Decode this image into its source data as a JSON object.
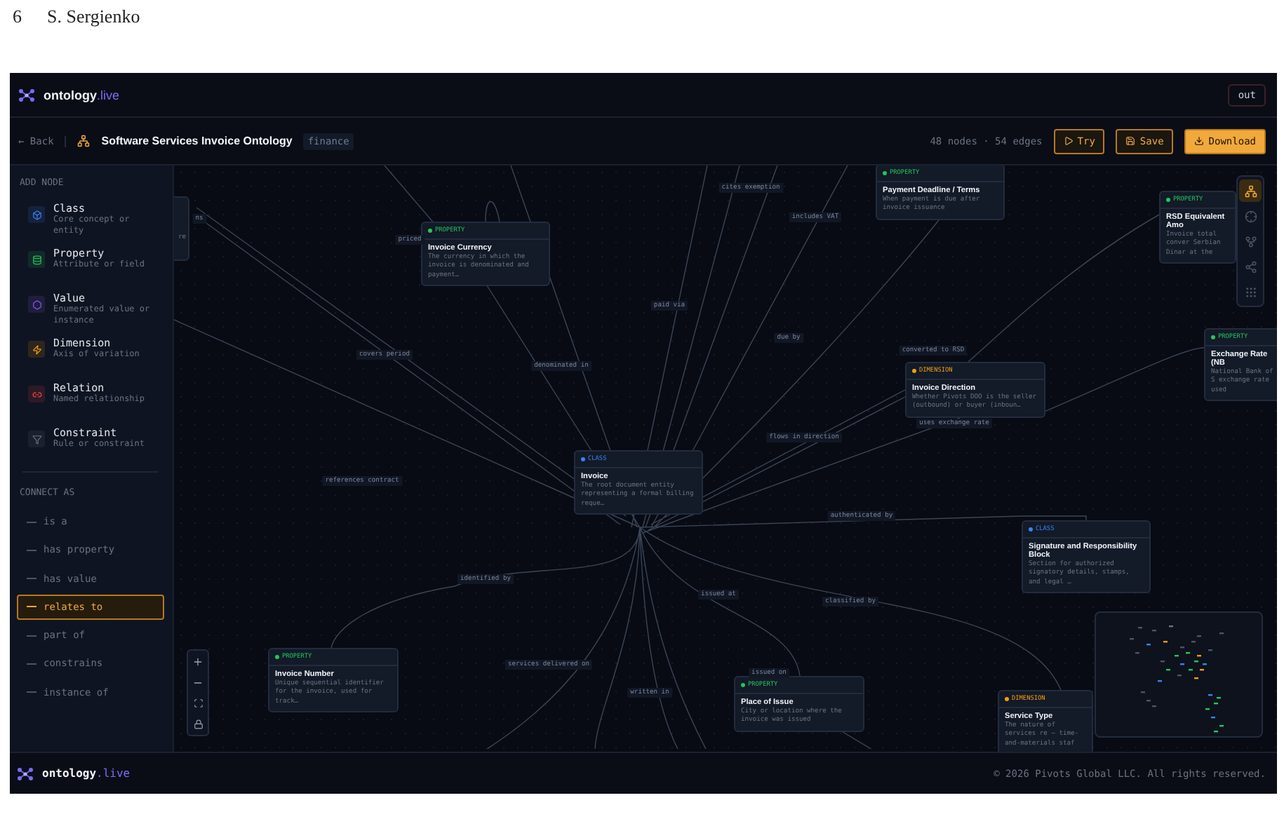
{
  "page_header": {
    "page_number": "6",
    "author": "S. Sergienko"
  },
  "app": {
    "logo": {
      "name": "ontology",
      "suffix": ".live"
    },
    "logout_button": "out",
    "toolbar": {
      "back": "← Back",
      "title": "Software Services Invoice Ontology",
      "tag": "finance",
      "stats": "48 nodes · 54 edges",
      "buttons": [
        {
          "kind": "try",
          "label": "Try"
        },
        {
          "kind": "save",
          "label": "Save"
        },
        {
          "kind": "download",
          "label": "Download"
        }
      ]
    },
    "sidebar": {
      "add_node_heading": "ADD NODE",
      "node_types": [
        {
          "kind": "class",
          "title": "Class",
          "subtitle": "Core concept or entity"
        },
        {
          "kind": "property",
          "title": "Property",
          "subtitle": "Attribute or field"
        },
        {
          "kind": "value",
          "title": "Value",
          "subtitle": "Enumerated value or instance"
        },
        {
          "kind": "dimension",
          "title": "Dimension",
          "subtitle": "Axis of variation"
        },
        {
          "kind": "relation",
          "title": "Relation",
          "subtitle": "Named relationship"
        },
        {
          "kind": "constraint",
          "title": "Constraint",
          "subtitle": "Rule or constraint"
        }
      ],
      "connect_heading": "CONNECT AS",
      "connect_as": [
        {
          "label": "is a",
          "selected": false
        },
        {
          "label": "has property",
          "selected": false
        },
        {
          "label": "has value",
          "selected": false
        },
        {
          "label": "relates to",
          "selected": true
        },
        {
          "label": "part of",
          "selected": false
        },
        {
          "label": "constrains",
          "selected": false
        },
        {
          "label": "instance of",
          "selected": false
        }
      ]
    },
    "canvas": {
      "nodes": [
        {
          "kind": "cut",
          "description": "re"
        },
        {
          "kind": "property",
          "type_label": "PROPERTY",
          "title": "Invoice Currency",
          "description": "The currency in which the invoice is denominated and payment…"
        },
        {
          "kind": "property",
          "type_label": "PROPERTY",
          "title": "Payment Deadline / Terms",
          "description": "When payment is due after invoice issuance"
        },
        {
          "kind": "property",
          "type_label": "PROPERTY",
          "title": "RSD Equivalent Amo",
          "description": "Invoice total conver Serbian Dinar at the"
        },
        {
          "kind": "property",
          "type_label": "PROPERTY",
          "title": "Exchange Rate (NB",
          "description": "National Bank of S exchange rate used"
        },
        {
          "kind": "dimension",
          "type_label": "DIMENSION",
          "title": "Invoice Direction",
          "description": "Whether Pivots DOO is the seller (outbound) or buyer (inboun…"
        },
        {
          "kind": "class",
          "type_label": "CLASS",
          "title": "Invoice",
          "description": "The root document entity representing a formal billing reque…"
        },
        {
          "kind": "class",
          "type_label": "CLASS",
          "title": "Signature and Responsibility Block",
          "description": "Section for authorized signatory details, stamps, and legal …"
        },
        {
          "kind": "property",
          "type_label": "PROPERTY",
          "title": "Invoice Number",
          "description": "Unique sequential identifier for the invoice, used for track…"
        },
        {
          "kind": "property",
          "type_label": "PROPERTY",
          "title": "Place of Issue",
          "description": "City or location where the invoice was issued"
        },
        {
          "kind": "dimension",
          "type_label": "DIMENSION",
          "title": "Service Type",
          "description": "The nature of services re – time-and-materials staf"
        }
      ],
      "edge_labels": [
        "ns",
        "cites exemption",
        "includes VAT",
        "priced",
        "paid via",
        "due by",
        "converted to RSD",
        "covers period",
        "denominated in",
        "uses exchange rate",
        "flows in direction",
        "references contract",
        "authenticated by",
        "identified by",
        "issued at",
        "classified by",
        "services delivered on",
        "issued on",
        "written in"
      ],
      "layout_tools": [
        {
          "kind": "hierarchy",
          "selected": true
        },
        {
          "kind": "radial",
          "selected": false
        },
        {
          "kind": "tree",
          "selected": false
        },
        {
          "kind": "force",
          "selected": false
        },
        {
          "kind": "grid",
          "selected": false
        }
      ]
    },
    "footer": {
      "logo": {
        "name": "ontology",
        "suffix": ".live"
      },
      "copyright": "© 2026 Pivots Global LLC. All rights reserved."
    }
  }
}
